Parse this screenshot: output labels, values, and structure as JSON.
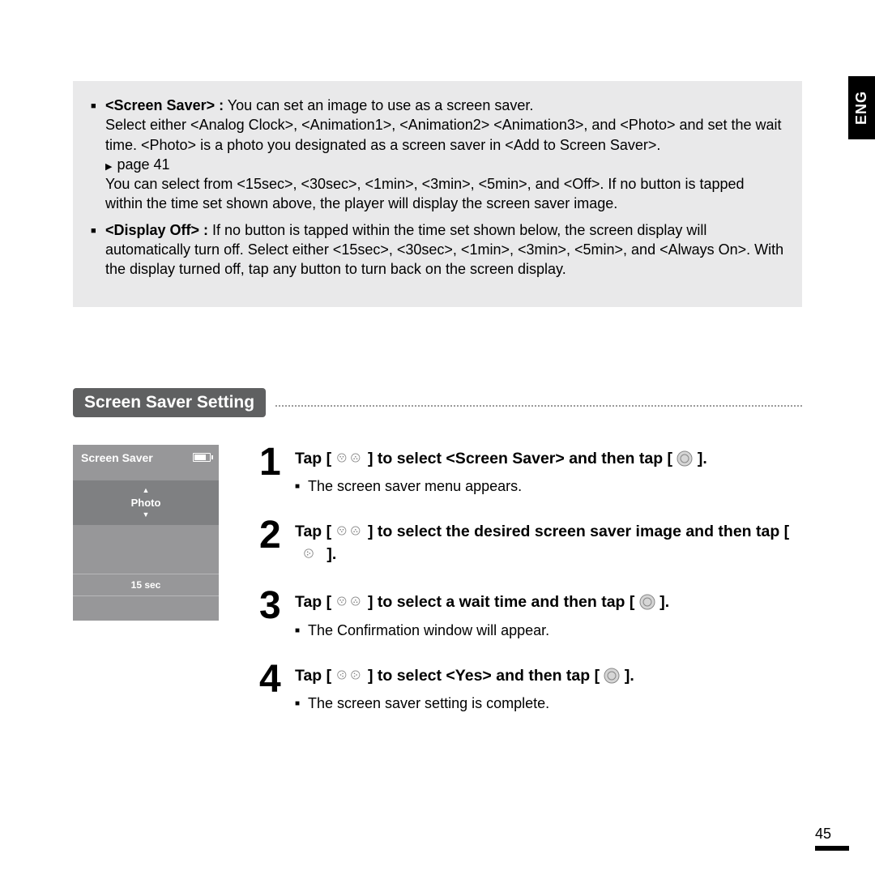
{
  "lang_tab": "ENG",
  "info": {
    "item1_label": "<Screen Saver> :",
    "item1_intro": " You can set an image to use as a screen saver.",
    "item1_line2": "Select either <Analog Clock>, <Animation1>, <Animation2> <Animation3>, and <Photo> and set the wait time. <Photo> is a photo you designated as a screen saver in <Add to Screen Saver>.",
    "item1_pageref": "page 41",
    "item1_line3": "You can select from <15sec>, <30sec>, <1min>, <3min>, <5min>, and <Off>. If no button is tapped within the time set shown above, the player will display the screen saver image.",
    "item2_label": "<Display Off> :",
    "item2_text": " If no button is tapped within the time set shown below, the screen display will automatically turn off. Select either <15sec>, <30sec>, <1min>, <3min>, <5min>, and <Always On>. With the display turned off, tap any button to turn back on the screen display."
  },
  "section_title": "Screen Saver Setting",
  "device": {
    "title": "Screen Saver",
    "selected": "Photo",
    "time": "15 sec"
  },
  "steps": {
    "s1": {
      "num": "1",
      "pre": "Tap [ ",
      "mid": " ] to select <Screen Saver> and then tap [ ",
      "post": " ].",
      "sub": "The screen saver menu appears."
    },
    "s2": {
      "num": "2",
      "pre": "Tap [ ",
      "mid": " ] to select the desired screen saver image and then tap [ ",
      "post": " ]."
    },
    "s3": {
      "num": "3",
      "pre": "Tap [ ",
      "mid": " ] to select a wait time and then tap [ ",
      "post": " ].",
      "sub": "The Confirmation window will appear."
    },
    "s4": {
      "num": "4",
      "pre": "Tap [ ",
      "mid": " ] to select <Yes> and then tap [ ",
      "post": " ].",
      "sub": "The screen saver setting is complete."
    }
  },
  "page_number": "45"
}
